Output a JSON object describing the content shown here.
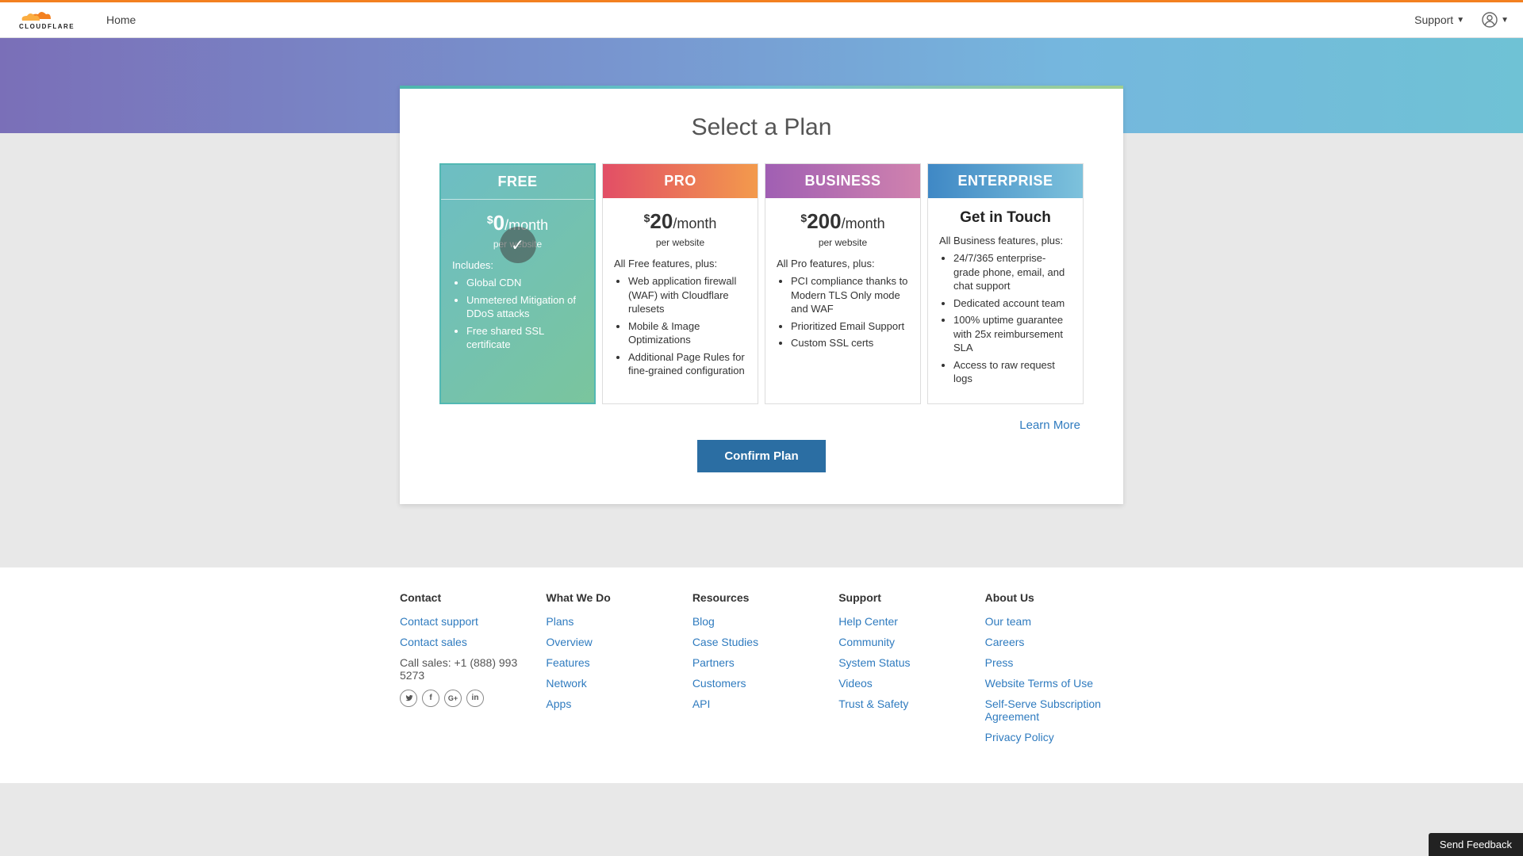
{
  "topbar": {
    "home": "Home",
    "support": "Support"
  },
  "page": {
    "title": "Select a Plan",
    "learn_more": "Learn More",
    "confirm": "Confirm Plan"
  },
  "plans": [
    {
      "name": "FREE",
      "currency": "$",
      "price": "0",
      "suffix": "/month",
      "per": "per website",
      "intro": "Includes:",
      "features": [
        "Global CDN",
        "Unmetered Mitigation of DDoS attacks",
        "Free shared SSL certificate"
      ]
    },
    {
      "name": "PRO",
      "currency": "$",
      "price": "20",
      "suffix": "/month",
      "per": "per website",
      "intro": "All Free features, plus:",
      "features": [
        "Web application firewall (WAF) with Cloudflare rulesets",
        "Mobile & Image Optimizations",
        "Additional Page Rules for fine-grained configuration"
      ]
    },
    {
      "name": "BUSINESS",
      "currency": "$",
      "price": "200",
      "suffix": "/month",
      "per": "per website",
      "intro": "All Pro features, plus:",
      "features": [
        "PCI compliance thanks to Modern TLS Only mode and WAF",
        "Prioritized Email Support",
        "Custom SSL certs"
      ]
    },
    {
      "name": "ENTERPRISE",
      "headline": "Get in Touch",
      "intro": "All Business features, plus:",
      "features": [
        "24/7/365 enterprise-grade phone, email, and chat support",
        "Dedicated account team",
        "100% uptime guarantee with 25x reimbursement SLA",
        "Access to raw request logs"
      ]
    }
  ],
  "footer": {
    "contact": {
      "heading": "Contact",
      "support": "Contact support",
      "sales": "Contact sales",
      "call": "Call sales: +1 (888) 993 5273"
    },
    "whatwedo": {
      "heading": "What We Do",
      "links": [
        "Plans",
        "Overview",
        "Features",
        "Network",
        "Apps"
      ]
    },
    "resources": {
      "heading": "Resources",
      "links": [
        "Blog",
        "Case Studies",
        "Partners",
        "Customers",
        "API"
      ]
    },
    "support": {
      "heading": "Support",
      "links": [
        "Help Center",
        "Community",
        "System Status",
        "Videos",
        "Trust & Safety"
      ]
    },
    "about": {
      "heading": "About Us",
      "links": [
        "Our team",
        "Careers",
        "Press",
        "Website Terms of Use",
        "Self-Serve Subscription Agreement",
        "Privacy Policy"
      ]
    }
  },
  "feedback": "Send Feedback"
}
